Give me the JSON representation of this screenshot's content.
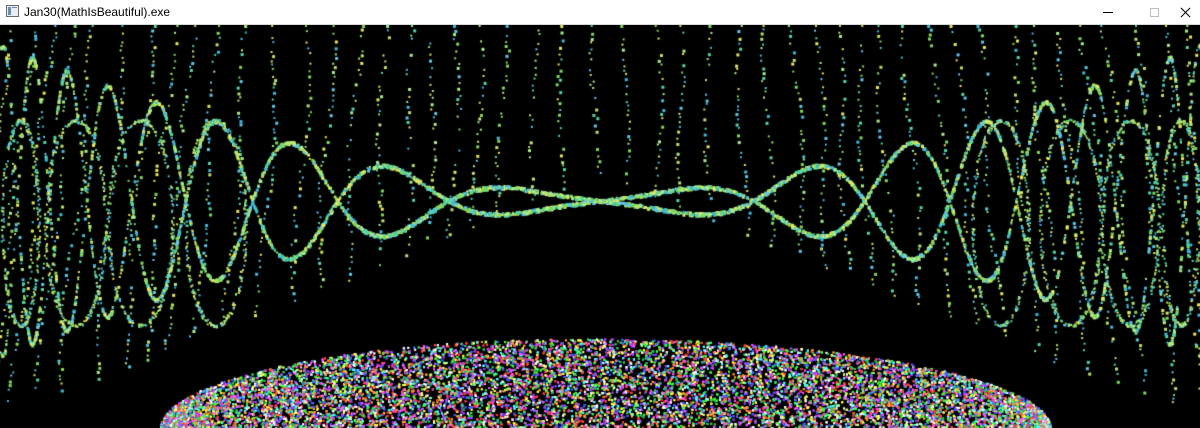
{
  "window": {
    "title": "Jan30(MathIsBeautiful).exe",
    "icon": "app-window-icon",
    "controls": {
      "minimize_icon": "minimize-icon",
      "maximize_icon": "maximize-icon",
      "close_icon": "close-icon"
    }
  },
  "canvas": {
    "background": "#000000",
    "palette_waves": [
      "#7fd957",
      "#4fd6a8",
      "#5fc7e8",
      "#b9e26a",
      "#3fb8d8",
      "#a8f08a",
      "#e6e85a"
    ],
    "palette_mound": [
      "#ff4040",
      "#40ff40",
      "#4060ff",
      "#ffff50",
      "#ff50ff",
      "#50ffff",
      "#ffffff",
      "#ff9a30",
      "#9a40ff",
      "#30c060"
    ]
  }
}
